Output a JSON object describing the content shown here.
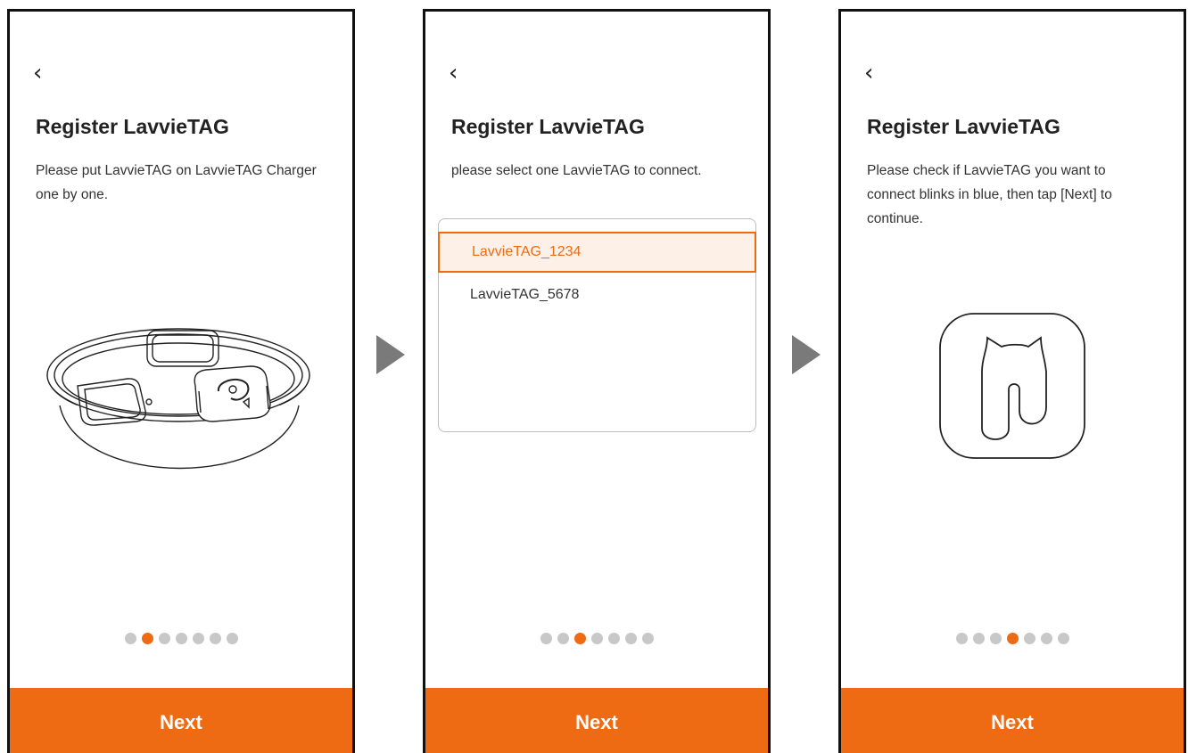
{
  "screens": [
    {
      "back_icon": "‹",
      "title": "Register LavvieTAG",
      "description": "Please put LavvieTAG on LavvieTAG Charger one by one.",
      "step_total": 7,
      "step_active": 2,
      "next_label": "Next"
    },
    {
      "back_icon": "‹",
      "title": "Register LavvieTAG",
      "description": "please select one LavvieTAG to connect.",
      "devices": [
        "LavvieTAG_1234",
        "LavvieTAG_5678"
      ],
      "selected_device": "LavvieTAG_1234",
      "step_total": 7,
      "step_active": 3,
      "next_label": "Next"
    },
    {
      "back_icon": "‹",
      "title": "Register LavvieTAG",
      "description": "Please check if LavvieTAG you want to connect blinks in blue, then tap [Next] to continue.",
      "step_total": 7,
      "step_active": 4,
      "next_label": "Next"
    }
  ],
  "colors": {
    "accent": "#ee6b14",
    "dot_inactive": "#c8c8c8",
    "selected_bg": "#fdf0e6",
    "arrow": "#7a7a7a"
  },
  "icons": {
    "back": "chevron-left-icon",
    "flow_arrow": "play-triangle-icon",
    "charger": "charger-illustration",
    "tag": "lavvietag-icon"
  }
}
